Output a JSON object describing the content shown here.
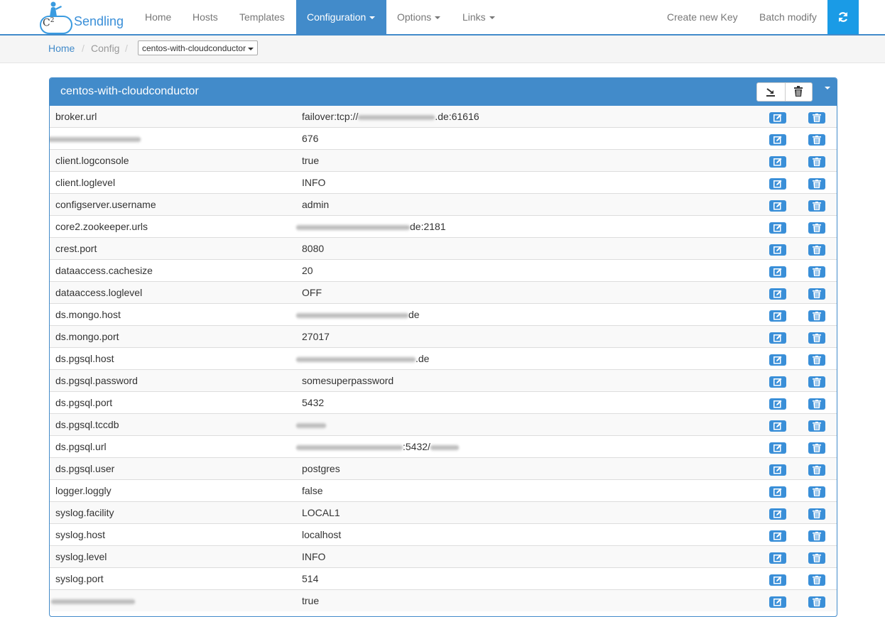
{
  "brand": {
    "name": "Sendling",
    "logo_text": "C",
    "logo_sup": "2"
  },
  "nav": {
    "items": [
      {
        "label": "Home"
      },
      {
        "label": "Hosts"
      },
      {
        "label": "Templates"
      },
      {
        "label": "Configuration",
        "active": true,
        "dropdown": true
      },
      {
        "label": "Options",
        "dropdown": true
      },
      {
        "label": "Links",
        "dropdown": true
      }
    ],
    "right": [
      {
        "label": "Create new Key"
      },
      {
        "label": "Batch modify"
      }
    ],
    "refresh_icon": "refresh-icon"
  },
  "breadcrumb": {
    "home": "Home",
    "config": "Config",
    "separator": "/",
    "selected_template": "centos-with-cloudconductor"
  },
  "panel": {
    "title": "centos-with-cloudconductor",
    "rows": [
      {
        "key": "broker.url",
        "value": "failover:tcp://",
        "value_suffix": ".de:61616",
        "redacted": true
      },
      {
        "key": "",
        "value": "676",
        "key_redacted": true
      },
      {
        "key": "client.logconsole",
        "value": "true"
      },
      {
        "key": "client.loglevel",
        "value": "INFO"
      },
      {
        "key": "configserver.username",
        "value": "admin"
      },
      {
        "key": "core2.zookeeper.urls",
        "value": "",
        "value_suffix": "de:2181",
        "redacted": true
      },
      {
        "key": "crest.port",
        "value": "8080"
      },
      {
        "key": "dataaccess.cachesize",
        "value": "20"
      },
      {
        "key": "dataaccess.loglevel",
        "value": "OFF"
      },
      {
        "key": "ds.mongo.host",
        "value": "",
        "value_suffix": "de",
        "redacted": true
      },
      {
        "key": "ds.mongo.port",
        "value": "27017"
      },
      {
        "key": "ds.pgsql.host",
        "value": "",
        "value_suffix": ".de",
        "redacted": true
      },
      {
        "key": "ds.pgsql.password",
        "value": "somesuperpassword"
      },
      {
        "key": "ds.pgsql.port",
        "value": "5432"
      },
      {
        "key": "ds.pgsql.tccdb",
        "value": "",
        "redacted": true
      },
      {
        "key": "ds.pgsql.url",
        "value": "",
        "value_suffix": ":5432/",
        "redacted": true
      },
      {
        "key": "ds.pgsql.user",
        "value": "postgres"
      },
      {
        "key": "logger.loggly",
        "value": "false"
      },
      {
        "key": "syslog.facility",
        "value": "LOCAL1"
      },
      {
        "key": "syslog.host",
        "value": "localhost"
      },
      {
        "key": "syslog.level",
        "value": "INFO"
      },
      {
        "key": "syslog.port",
        "value": "514"
      },
      {
        "key": "",
        "value": "true",
        "key_redacted": true
      }
    ]
  },
  "colors": {
    "primary": "#428bca",
    "refresh": "#1a9be6",
    "nav_text": "#777777",
    "link": "#428bca"
  }
}
